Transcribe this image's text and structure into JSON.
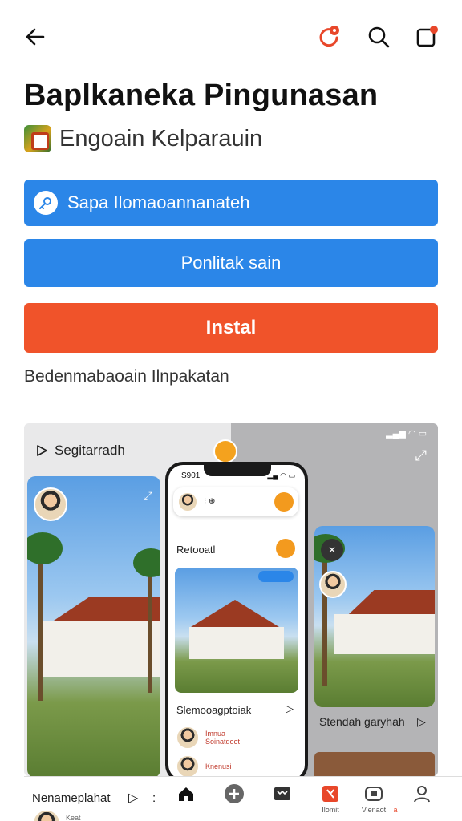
{
  "app": {
    "title": "Baplkaneka Pingunasan",
    "developer": "Engoain Kelparauin"
  },
  "topbar": {
    "back_icon": "arrow-left-icon",
    "notification_icon": "notification-icon",
    "search_icon": "search-icon",
    "share_icon": "share-icon",
    "accent": "#e8472a"
  },
  "buttons": {
    "open_label": "Sapa Ilomaoannanateh",
    "secondary_label": "Ponlitak sain",
    "install_label": "Instal"
  },
  "description": "Bedenmabaoain Ilnpakatan",
  "gallery": {
    "label": "Segitarradh",
    "phone_time": "S901",
    "phone_section": "Retooatl",
    "phone_caption": "Slemooagptoiak",
    "phone_rows": [
      {
        "title": "Imnua",
        "subtitle": "Soinatdoet"
      },
      {
        "title": "Knenusi",
        "subtitle": ""
      }
    ],
    "right_caption": "Stendah garyhah"
  },
  "bottom_nav": {
    "left_label": "Nenameplahat",
    "left_colon": ":",
    "items": [
      {
        "name": "home",
        "label": ""
      },
      {
        "name": "add",
        "label": ""
      },
      {
        "name": "library",
        "label": ""
      },
      {
        "name": "apps",
        "label": "Ilomit"
      },
      {
        "name": "video",
        "label": "Vienaot"
      },
      {
        "name": "profile",
        "label": ""
      }
    ],
    "small_label": "Keat",
    "extra_label": "a"
  },
  "colors": {
    "primary_blue": "#2b86e8",
    "install_orange": "#f0532a",
    "badge_orange": "#f39a1e"
  }
}
